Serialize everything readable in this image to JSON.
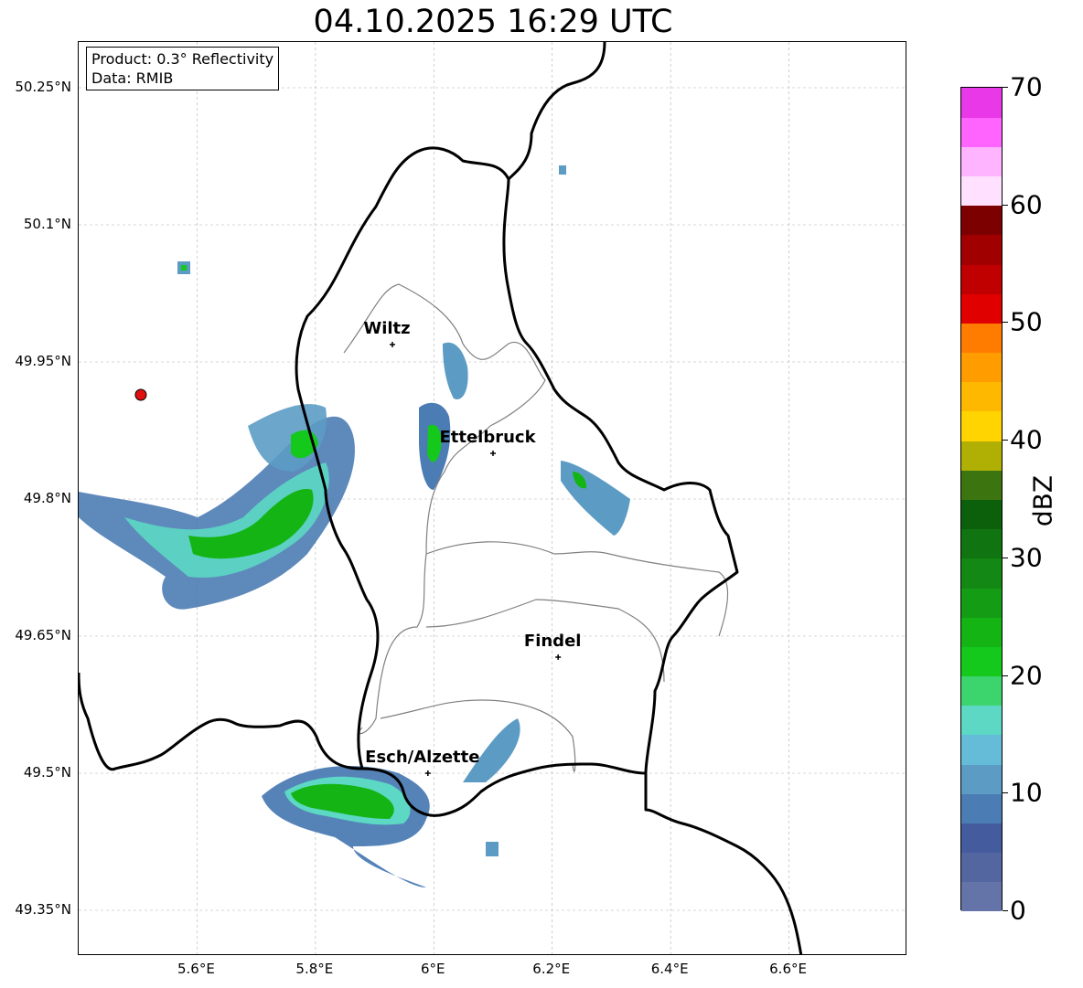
{
  "title": "04.10.2025 16:29 UTC",
  "info": {
    "product": "Product: 0.3° Reflectivity",
    "data": "Data: RMIB"
  },
  "map": {
    "lon_range": [
      5.4,
      6.8
    ],
    "lat_range": [
      49.3,
      50.3
    ],
    "y_ticks": [
      {
        "value": 49.35,
        "label": "49.35°N"
      },
      {
        "value": 49.5,
        "label": "49.5°N"
      },
      {
        "value": 49.65,
        "label": "49.65°N"
      },
      {
        "value": 49.8,
        "label": "49.8°N"
      },
      {
        "value": 49.95,
        "label": "49.95°N"
      },
      {
        "value": 50.1,
        "label": "50.1°N"
      },
      {
        "value": 50.25,
        "label": "50.25°N"
      }
    ],
    "x_ticks": [
      {
        "value": 5.6,
        "label": "5.6°E"
      },
      {
        "value": 5.8,
        "label": "5.8°E"
      },
      {
        "value": 6.0,
        "label": "6°E"
      },
      {
        "value": 6.2,
        "label": "6.2°E"
      },
      {
        "value": 6.4,
        "label": "6.4°E"
      },
      {
        "value": 6.6,
        "label": "6.6°E"
      }
    ],
    "cities": [
      {
        "name": "Wiltz",
        "lon": 5.93,
        "lat": 49.969
      },
      {
        "name": "Ettelbruck",
        "lon": 6.1,
        "lat": 49.85
      },
      {
        "name": "Findel",
        "lon": 6.21,
        "lat": 49.627
      },
      {
        "name": "Esch/Alzette",
        "lon": 5.99,
        "lat": 49.5
      }
    ],
    "radar_site": {
      "lon": 5.505,
      "lat": 49.914,
      "color": "#e01010"
    }
  },
  "colorbar": {
    "unit": "dBZ",
    "min": 0,
    "max": 70,
    "step": 2.5,
    "tick_labels": [
      "0",
      "10",
      "20",
      "30",
      "40",
      "50",
      "60",
      "70"
    ],
    "colors": [
      "#6474a8",
      "#5466a0",
      "#445c9e",
      "#4c7cb4",
      "#5c9cc4",
      "#64bcd8",
      "#5cd8c4",
      "#3cd46c",
      "#14c81c",
      "#14b414",
      "#149c14",
      "#148814",
      "#107410",
      "#0c600c",
      "#3c7410",
      "#b0b004",
      "#ffd400",
      "#ffb800",
      "#ff9c00",
      "#ff7c00",
      "#e00000",
      "#c00000",
      "#a00000",
      "#7c0000",
      "#ffe0ff",
      "#ffb4ff",
      "#ff64ff",
      "#e838e8"
    ]
  }
}
